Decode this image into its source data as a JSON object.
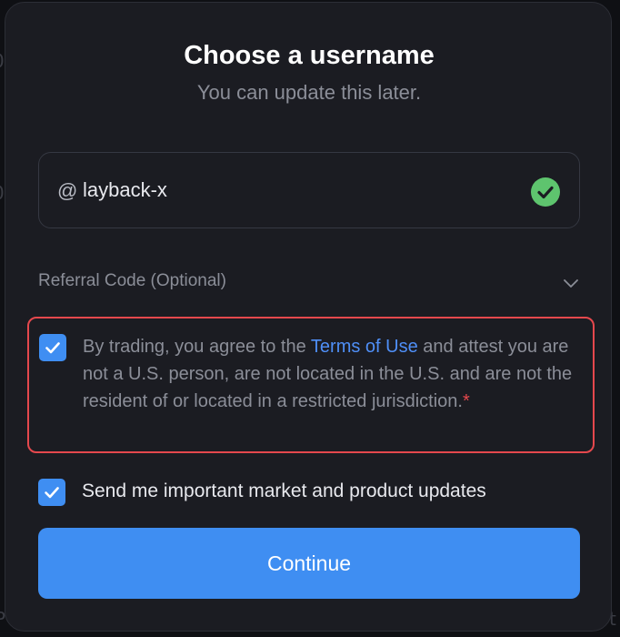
{
  "modal": {
    "title": "Choose a username",
    "subtitle": "You can update this later."
  },
  "username": {
    "prefix": "@",
    "value": "layback-x",
    "status_icon": "check-circle-icon",
    "status": "valid"
  },
  "referral": {
    "label": "Referral Code (Optional)",
    "icon": "chevron-down-icon",
    "expanded": false
  },
  "terms": {
    "checked": true,
    "text_before": "By trading, you agree to the ",
    "link_label": "Terms of Use",
    "text_after": " and attest you are not a U.S. person, are not located in the U.S. and are not the resident of or located in a restricted jurisdiction.",
    "required_marker": "*"
  },
  "updates": {
    "checked": true,
    "label": "Send me important market and product updates"
  },
  "continue_button": {
    "label": "Continue"
  },
  "colors": {
    "accent": "#3f8ef2",
    "success": "#5ec46e",
    "error": "#e5484d",
    "link": "#4f8ff7",
    "modal_bg": "#1b1c22"
  }
}
